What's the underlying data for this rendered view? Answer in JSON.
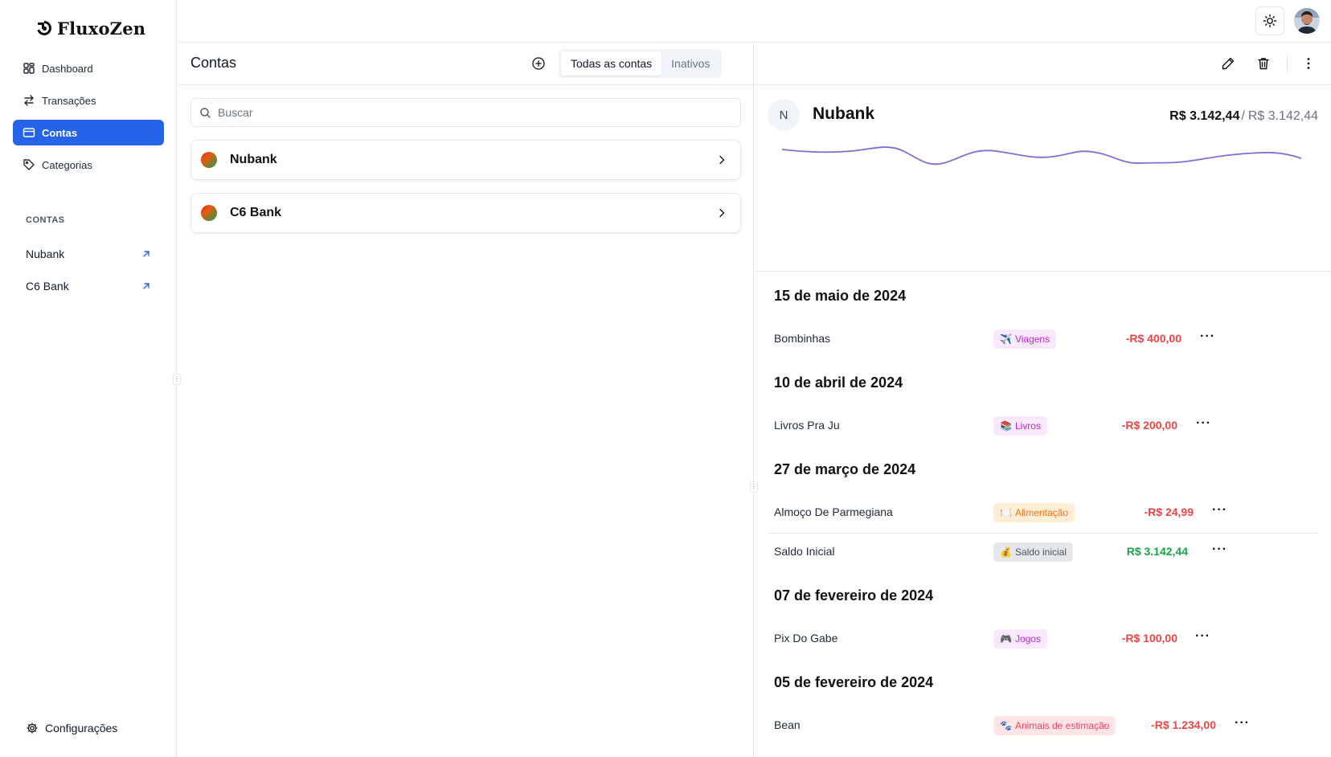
{
  "app": {
    "name": "FluxoZen"
  },
  "sidebar": {
    "nav": [
      {
        "label": "Dashboard",
        "icon": "grid-icon"
      },
      {
        "label": "Transações",
        "icon": "arrows-icon"
      },
      {
        "label": "Contas",
        "icon": "card-icon",
        "active": true
      },
      {
        "label": "Categorias",
        "icon": "tag-icon"
      }
    ],
    "section_label": "CONTAS",
    "accounts": [
      {
        "label": "Nubank"
      },
      {
        "label": "C6 Bank"
      }
    ],
    "settings_label": "Configurações"
  },
  "list": {
    "title": "Contas",
    "tabs": [
      {
        "label": "Todas as contas",
        "active": true
      },
      {
        "label": "Inativos"
      }
    ],
    "search_placeholder": "Buscar",
    "accounts": [
      {
        "name": "Nubank"
      },
      {
        "name": "C6 Bank"
      }
    ]
  },
  "detail": {
    "initial": "N",
    "name": "Nubank",
    "balance": "R$ 3.142,44",
    "separator": "/",
    "total": "R$ 3.142,44",
    "groups": [
      {
        "date": "15 de maio de 2024",
        "items": [
          {
            "desc": "Bombinhas",
            "emoji": "✈️",
            "category": "Viagens",
            "amount": "-R$ 400,00"
          }
        ]
      },
      {
        "date": "10 de abril de 2024",
        "items": [
          {
            "desc": "Livros Pra Ju",
            "emoji": "📚",
            "category": "Livros",
            "amount": "-R$ 200,00"
          }
        ]
      },
      {
        "date": "27 de março de 2024",
        "items": [
          {
            "desc": "Almoço De Parmegiana",
            "emoji": "🍽️",
            "category": "Alimentação",
            "amount": "-R$ 24,99"
          },
          {
            "desc": "Saldo Inicial",
            "emoji": "💰",
            "category": "Saldo inicial",
            "amount": "R$ 3.142,44"
          }
        ]
      },
      {
        "date": "07 de fevereiro de 2024",
        "items": [
          {
            "desc": "Pix Do Gabe",
            "emoji": "🎮",
            "category": "Jogos",
            "amount": "-R$ 100,00"
          }
        ]
      },
      {
        "date": "05 de fevereiro de 2024",
        "items": [
          {
            "desc": "Bean",
            "emoji": "🐾",
            "category": "Animais de estimação",
            "amount": "-R$ 1.234,00"
          }
        ]
      }
    ],
    "more_label": "···"
  },
  "colors": {
    "accent": "#2563eb",
    "negative": "#ef4444",
    "positive": "#16a34a",
    "chart_line": "#7c6fd6",
    "tag_viagens_bg": "#fae8ff",
    "tag_viagens_fg": "#c026d3",
    "tag_livros_bg": "#fae8ff",
    "tag_livros_fg": "#c026d3",
    "tag_alimentacao_bg": "#ffedd5",
    "tag_alimentacao_fg": "#f97316",
    "tag_saldo_bg": "#e5e7eb",
    "tag_saldo_fg": "#4b5563",
    "tag_jogos_bg": "#fae8ff",
    "tag_jogos_fg": "#c026d3",
    "tag_animais_bg": "#ffe4e6",
    "tag_animais_fg": "#f43f5e"
  }
}
